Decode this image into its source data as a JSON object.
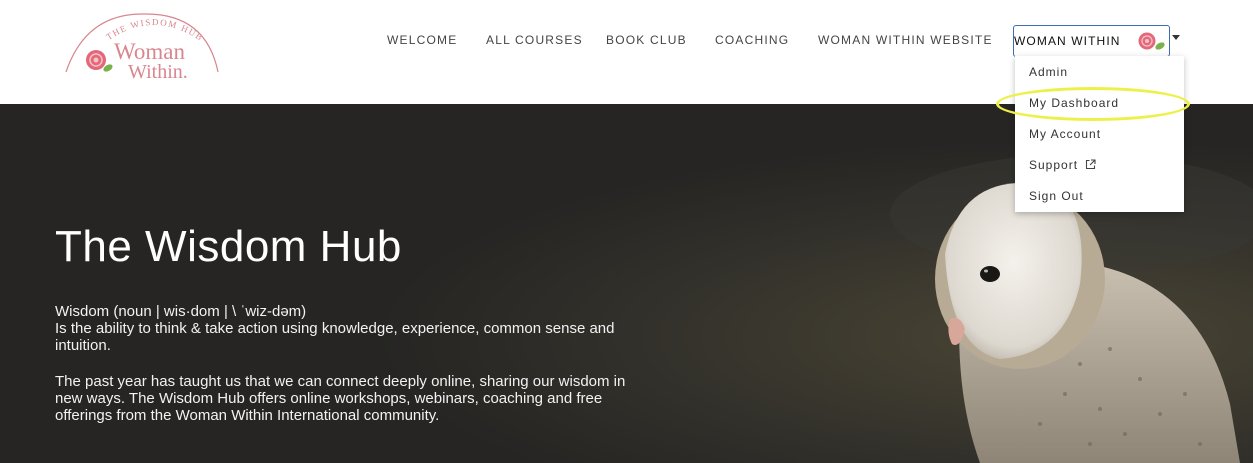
{
  "logo": {
    "tagline": "THE WISDOM HUB",
    "line1": "Woman",
    "line2": "Within."
  },
  "nav": {
    "items": [
      {
        "label": "WELCOME"
      },
      {
        "label": "ALL COURSES"
      },
      {
        "label": "BOOK CLUB"
      },
      {
        "label": "COACHING"
      },
      {
        "label": "WOMAN WITHIN WEBSITE"
      }
    ]
  },
  "user_menu": {
    "name": "WOMAN WITHIN I",
    "items": [
      {
        "label": "Admin"
      },
      {
        "label": "My Dashboard"
      },
      {
        "label": "My Account"
      },
      {
        "label": "Support"
      },
      {
        "label": "Sign Out"
      }
    ],
    "highlighted_item": "My Dashboard"
  },
  "hero": {
    "title": "The Wisdom Hub",
    "definition_line1": "Wisdom (noun | wis·dom | \\ ˈwiz-dəm)",
    "definition_line2": "Is the ability to think & take action using knowledge, experience, common sense and intuition.",
    "paragraph": "The past year has taught us that we can connect deeply online, sharing our wisdom in new ways. The Wisdom Hub offers online workshops, webinars, coaching and free offerings from the Woman Within International community."
  },
  "colors": {
    "brand_pink": "#d8868f",
    "button_border": "#3d6bb5",
    "highlight": "#eef04a",
    "hero_bg": "#2b2a27"
  }
}
